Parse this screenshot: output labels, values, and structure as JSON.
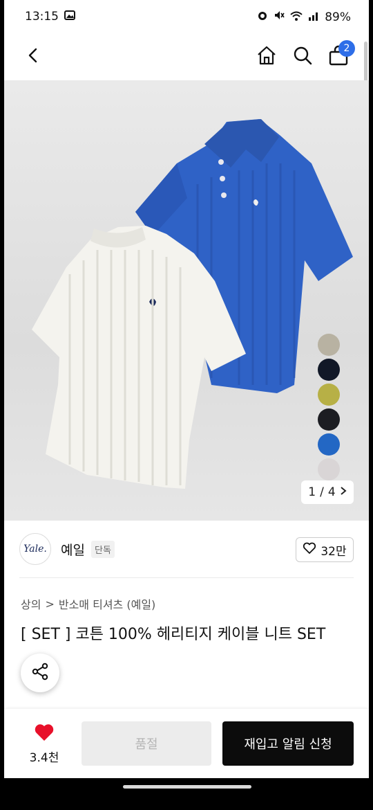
{
  "status_bar": {
    "time": "13:15",
    "battery": "89%",
    "left_icons": [
      "image-icon"
    ],
    "right_icons": [
      "alarm-icon",
      "mute-icon",
      "wifi-icon",
      "signal-icon"
    ]
  },
  "nav": {
    "cart_count": "2",
    "icons": [
      "back-icon",
      "home-icon",
      "search-icon",
      "cart-icon"
    ]
  },
  "gallery": {
    "current": "1",
    "total": "4",
    "separator": "/",
    "swatch_colors": [
      "#b8b2a2",
      "#111827",
      "#b7b046",
      "#1c1d22",
      "#2367c4",
      "#d9d5d6"
    ]
  },
  "brand": {
    "logo_text": "Yale.",
    "name": "예일",
    "tag": "단독"
  },
  "like": {
    "count": "32만"
  },
  "breadcrumb": {
    "level1": "상의",
    "separator": ">",
    "level2": "반소매 티셔츠 (예일)"
  },
  "product": {
    "title": "[ SET ] 코튼 100% 헤리티지 케이블 니트 SET"
  },
  "bottom_bar": {
    "wish_count": "3.4천",
    "soldout_label": "품절",
    "restock_label": "재입고 알림 신청"
  },
  "colors": {
    "accent_badge": "#2e6ee8",
    "heart": "#e8102a",
    "primary_button": "#0c0c0c"
  }
}
